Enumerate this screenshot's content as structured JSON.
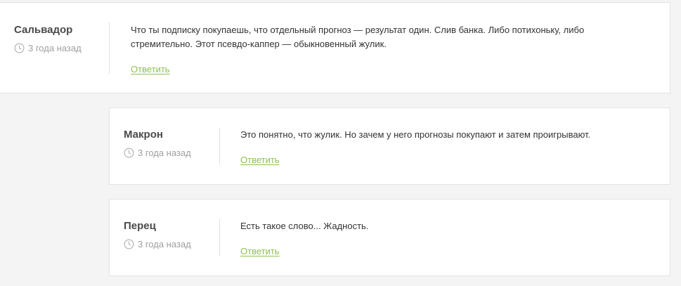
{
  "comments": [
    {
      "author": "Сальвадор",
      "time": "3 года назад",
      "text": "Что ты подписку покупаешь, что отдельный прогноз — результат один. Слив банка. Либо потихоньку, либо стремительно. Этот псевдо-каппер — обыкновенный жулик.",
      "reply_label": "Ответить"
    },
    {
      "author": "Макрон",
      "time": "3 года назад",
      "text": "Это понятно, что жулик. Но зачем у него прогнозы покупают и затем проигрывают.",
      "reply_label": "Ответить"
    },
    {
      "author": "Перец",
      "time": "3 года назад",
      "text": "Есть такое слово... Жадность.",
      "reply_label": "Ответить"
    }
  ],
  "icons": {
    "time": "clock-icon"
  },
  "colors": {
    "reply_link": "#8cc152",
    "background": "#f4f4f4",
    "card": "#ffffff"
  }
}
